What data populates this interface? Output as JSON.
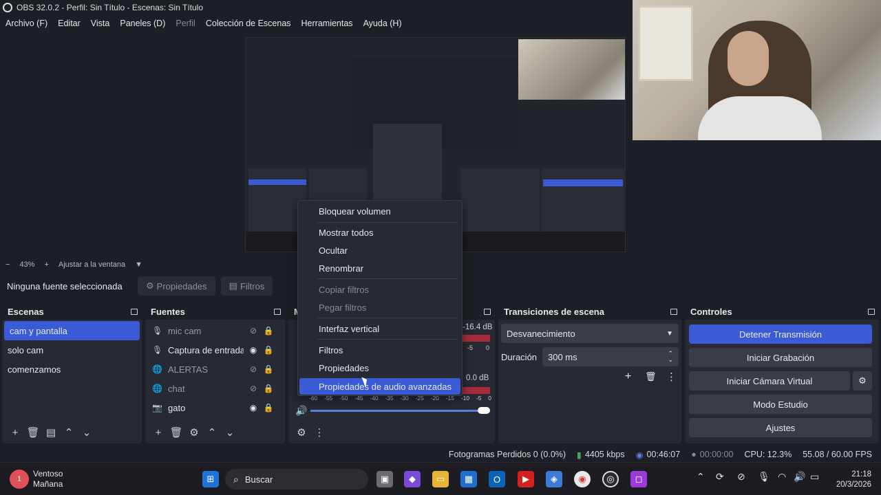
{
  "window_title": "OBS 32.0.2 - Perfil: Sin Título - Escenas: Sin Título",
  "menu": [
    "Archivo (F)",
    "Editar",
    "Vista",
    "Paneles (D)",
    "Perfil",
    "Colección de Escenas",
    "Herramientas",
    "Ayuda (H)"
  ],
  "preview": {
    "zoom_minus": "−",
    "zoom": "43%",
    "zoom_plus": "+",
    "fit": "Ajustar a la ventana"
  },
  "source_toolbar": {
    "no_source": "Ninguna fuente seleccionada",
    "properties": "Propiedades",
    "filters": "Filtros"
  },
  "scenes": {
    "title": "Escenas",
    "items": [
      "cam y pantalla",
      "solo cam",
      "comenzamos"
    ],
    "selected": "cam y pantalla"
  },
  "sources": {
    "title": "Fuentes",
    "items": [
      {
        "name": "mic cam",
        "icon": "mic-icon",
        "visible": false
      },
      {
        "name": "Captura de entrada",
        "icon": "mic-icon",
        "visible": true
      },
      {
        "name": "ALERTAS",
        "icon": "globe-icon",
        "visible": false
      },
      {
        "name": "chat",
        "icon": "globe-icon",
        "visible": false
      },
      {
        "name": "gato",
        "icon": "camera-icon",
        "visible": true
      }
    ]
  },
  "mixer": {
    "title_initial": "M",
    "level1": "-16.4 dB",
    "level2": "0.0 dB",
    "scale": [
      "-60",
      "-55",
      "-50",
      "-45",
      "-40",
      "-35",
      "-30",
      "-25",
      "-20",
      "-15",
      "-10",
      "-5",
      "0"
    ],
    "partial_scale": [
      "-5",
      "0"
    ]
  },
  "transitions": {
    "title": "Transiciones de escena",
    "type": "Desvanecimiento",
    "duration_label": "Duración",
    "duration": "300 ms"
  },
  "controls": {
    "title": "Controles",
    "stop_stream": "Detener Transmisión",
    "start_record": "Iniciar Grabación",
    "virtual_cam": "Iniciar Cámara Virtual",
    "studio": "Modo Estudio",
    "settings": "Ajustes"
  },
  "context_menu": {
    "items": [
      {
        "label": "Bloquear volumen",
        "state": "normal"
      },
      {
        "label": "Mostrar todos",
        "state": "normal"
      },
      {
        "label": "Ocultar",
        "state": "normal"
      },
      {
        "label": "Renombrar",
        "state": "normal"
      },
      {
        "label": "Copiar filtros",
        "state": "disabled"
      },
      {
        "label": "Pegar filtros",
        "state": "disabled"
      },
      {
        "label": "Interfaz vertical",
        "state": "normal"
      },
      {
        "label": "Filtros",
        "state": "normal"
      },
      {
        "label": "Propiedades",
        "state": "normal"
      },
      {
        "label": "Propiedades de audio avanzadas",
        "state": "highlighted"
      }
    ]
  },
  "status": {
    "dropped": "Fotogramas Perdidos 0 (0.0%)",
    "bitrate": "4405 kbps",
    "stream_time": "00:46:07",
    "rec_time": "00:00:00",
    "cpu": "CPU: 12.3%",
    "fps": "55.08 / 60.00 FPS"
  },
  "taskbar": {
    "weather_title": "Ventoso",
    "weather_sub": "Mañana",
    "weather_badge": "1",
    "search": "Buscar",
    "time": "21:18",
    "date": "20/3/2026"
  },
  "colors": {
    "accent": "#3b5bd6",
    "background": "#1d1f26",
    "panel": "#272a33",
    "meter_green": "#4aa35b",
    "meter_red": "#a52a3a"
  }
}
